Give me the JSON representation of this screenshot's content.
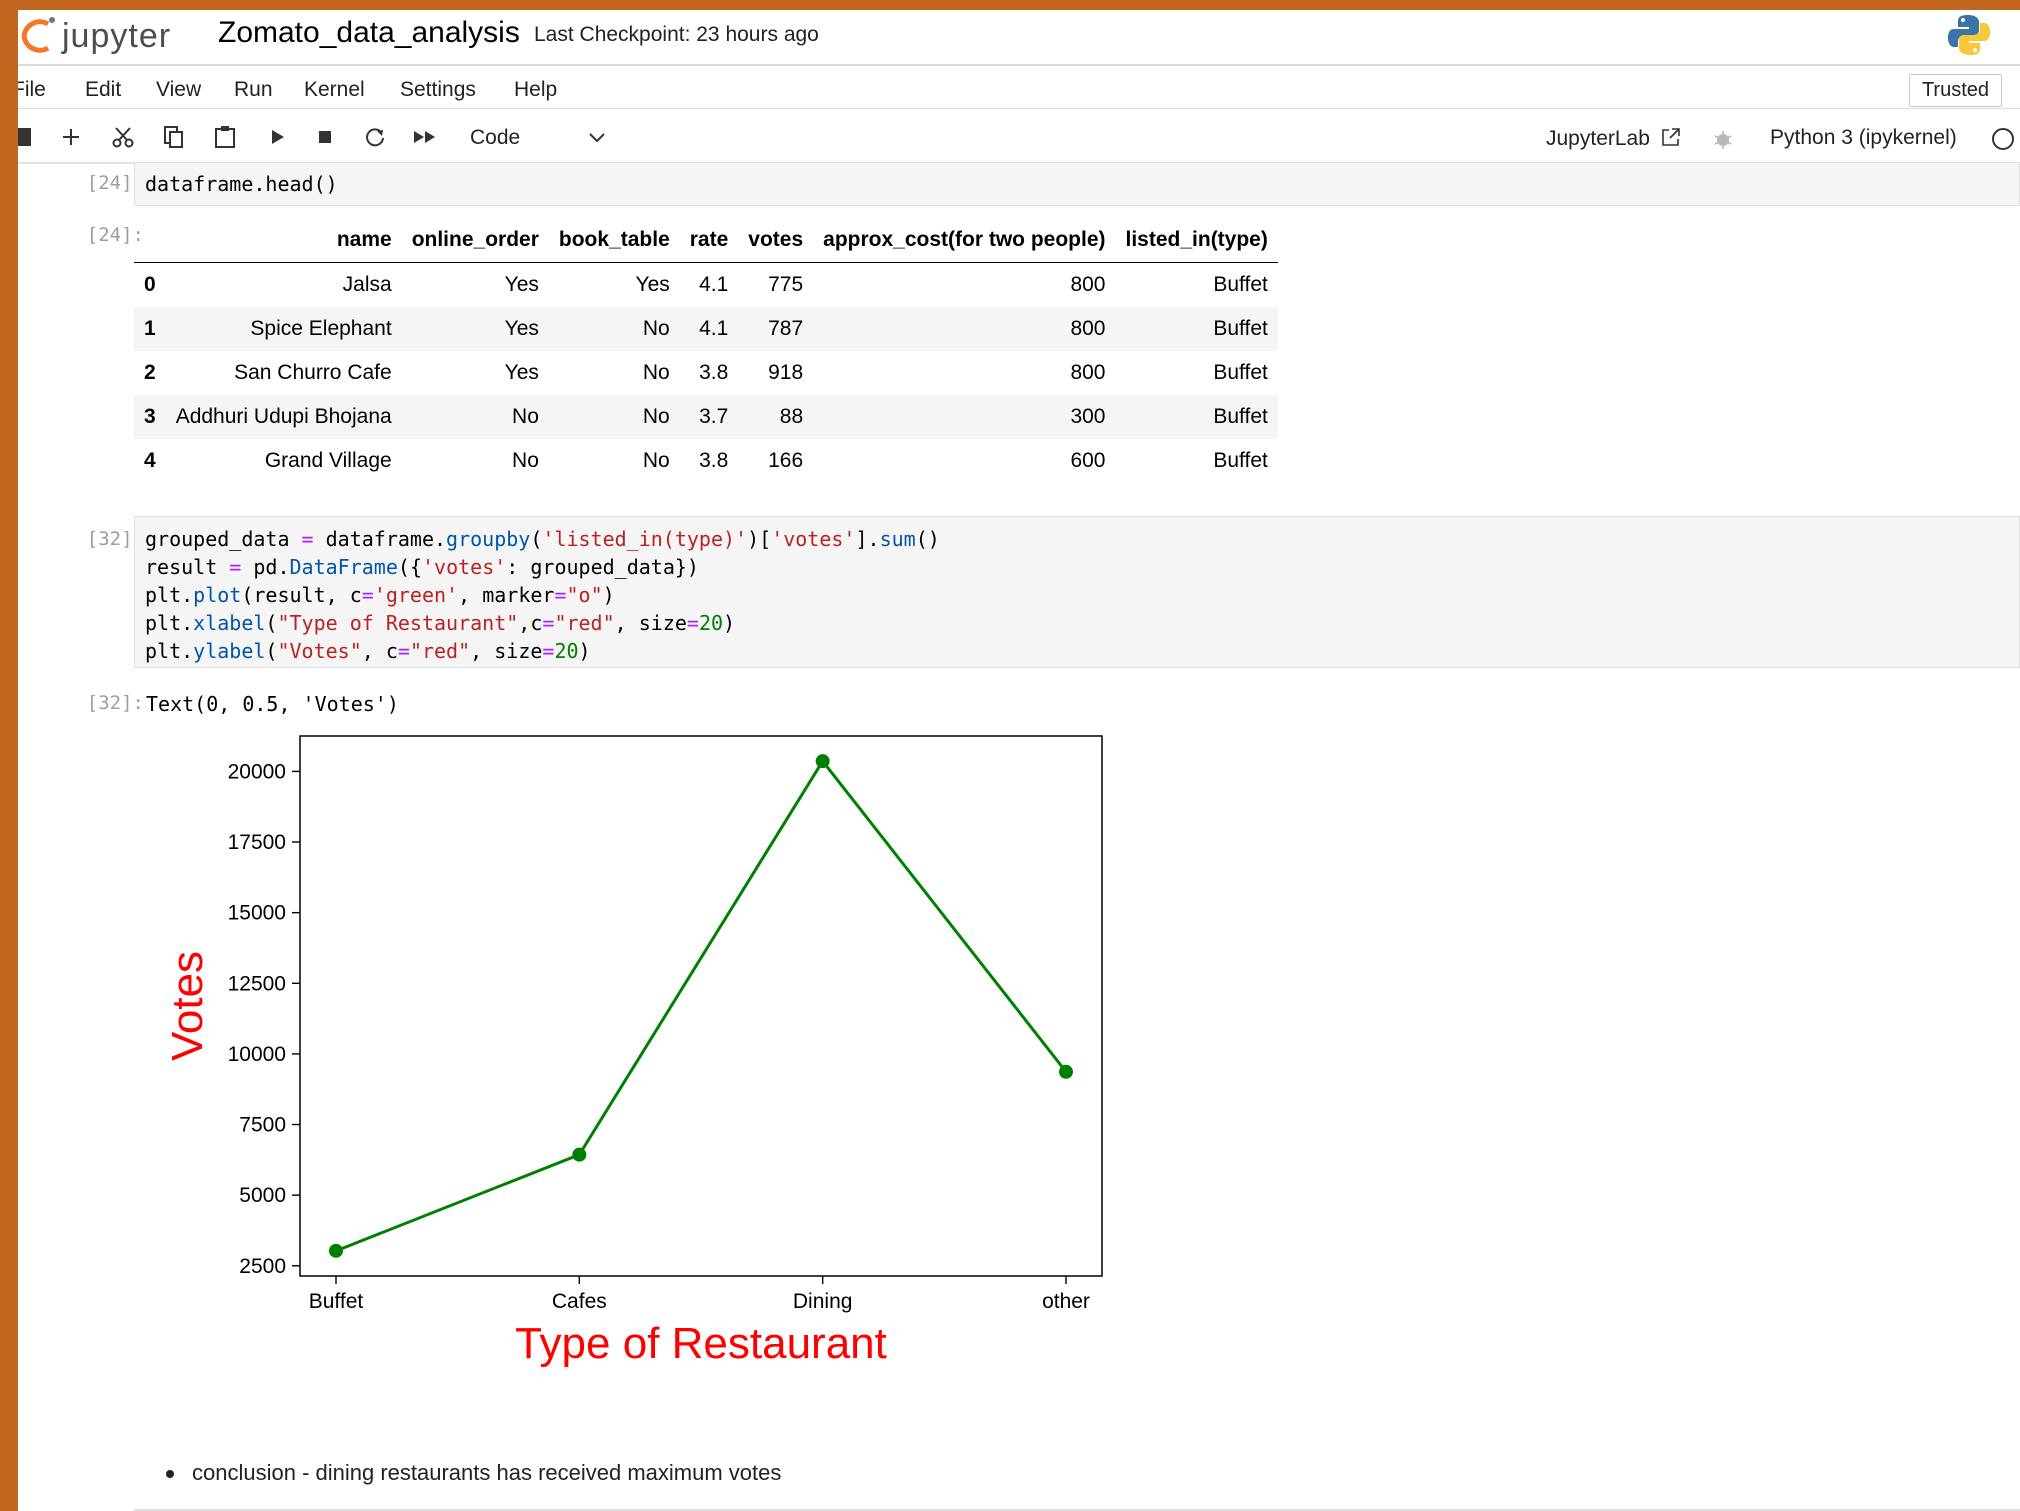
{
  "header": {
    "logo_text": "jupyter",
    "notebook_title": "Zomato_data_analysis",
    "checkpoint": "Last Checkpoint: 23 hours ago"
  },
  "menu": {
    "items": [
      "File",
      "Edit",
      "View",
      "Run",
      "Kernel",
      "Settings",
      "Help"
    ],
    "trusted": "Trusted"
  },
  "toolbar": {
    "icons": [
      "save-icon",
      "add-cell-icon",
      "cut-icon",
      "copy-icon",
      "paste-icon",
      "run-icon",
      "stop-icon",
      "restart-icon",
      "fast-forward-icon"
    ],
    "cell_type": "Code",
    "jupyterlab_link": "JupyterLab",
    "kernel_name": "Python 3 (ipykernel)"
  },
  "cells": {
    "cell1_prompt_in": "[24]:",
    "cell1_code": "dataframe.head()",
    "cell1_prompt_out": "[24]:",
    "cell2_prompt_in": "[32]:",
    "cell2_prompt_out": "[32]:",
    "cell2_output_text": "Text(0, 0.5, 'Votes')"
  },
  "dataframe": {
    "columns": [
      "",
      "name",
      "online_order",
      "book_table",
      "rate",
      "votes",
      "approx_cost(for two people)",
      "listed_in(type)"
    ],
    "rows": [
      [
        "0",
        "Jalsa",
        "Yes",
        "Yes",
        "4.1",
        "775",
        "800",
        "Buffet"
      ],
      [
        "1",
        "Spice Elephant",
        "Yes",
        "No",
        "4.1",
        "787",
        "800",
        "Buffet"
      ],
      [
        "2",
        "San Churro Cafe",
        "Yes",
        "No",
        "3.8",
        "918",
        "800",
        "Buffet"
      ],
      [
        "3",
        "Addhuri Udupi Bhojana",
        "No",
        "No",
        "3.7",
        "88",
        "300",
        "Buffet"
      ],
      [
        "4",
        "Grand Village",
        "No",
        "No",
        "3.8",
        "166",
        "600",
        "Buffet"
      ]
    ]
  },
  "code_lines": [
    "grouped_data = dataframe.groupby('listed_in(type)')['votes'].sum()",
    "result = pd.DataFrame({'votes': grouped_data})",
    "plt.plot(result, c='green', marker=\"o\")",
    "plt.xlabel(\"Type of Restaurant\",c=\"red\", size=20)",
    "plt.ylabel(\"Votes\", c=\"red\", size=20)"
  ],
  "chart_data": {
    "type": "line",
    "categories": [
      "Buffet",
      "Cafes",
      "Dining",
      "other"
    ],
    "series": [
      {
        "values": [
          3028,
          6434,
          20363,
          9367
        ],
        "color": "#008000",
        "marker": "o"
      }
    ],
    "xlabel": "Type of Restaurant",
    "ylabel": "Votes",
    "label_color": "#ff0000",
    "yticks": [
      2500,
      5000,
      7500,
      10000,
      12500,
      15000,
      17500,
      20000
    ],
    "ylim": [
      2138,
      21253
    ],
    "grid": false
  },
  "conclusion": "conclusion - dining restaurants has received maximum votes"
}
